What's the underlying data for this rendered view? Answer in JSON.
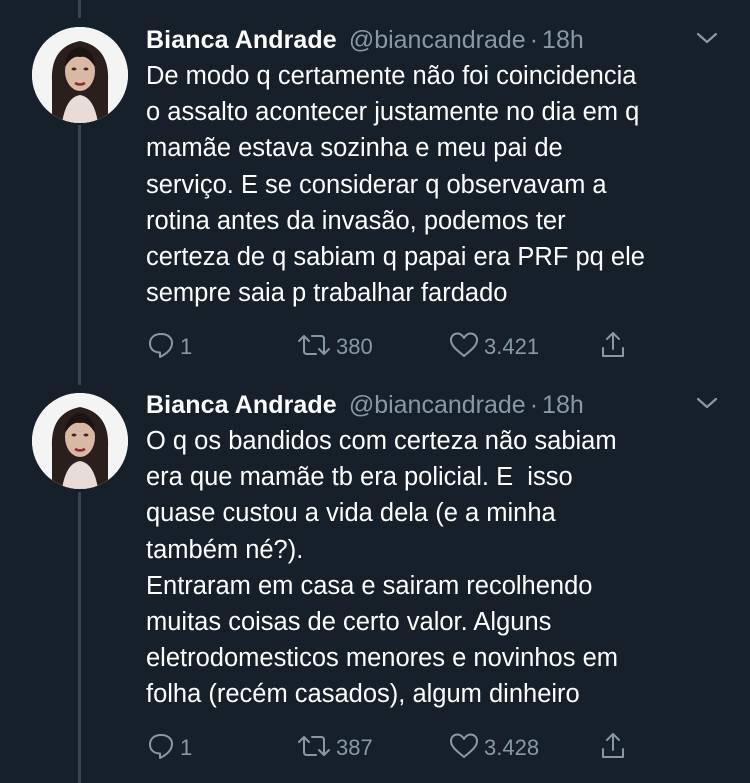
{
  "tweets": [
    {
      "name": "Bianca Andrade",
      "handle": "@biancandrade",
      "separator": "·",
      "time": "18h",
      "lines": [
        "De modo q certamente não foi coincidencia",
        "o assalto acontecer justamente no dia em q",
        "mamãe estava sozinha e meu pai de",
        "serviço. E se considerar q observavam a",
        "rotina antes da invasão, podemos ter",
        "certeza de q sabiam q papai era PRF pq ele",
        "sempre saia p trabalhar fardado"
      ],
      "replies": "1",
      "retweets": "380",
      "likes": "3.421"
    },
    {
      "name": "Bianca Andrade",
      "handle": "@biancandrade",
      "separator": "·",
      "time": "18h",
      "lines": [
        "O q os bandidos com certeza não sabiam",
        "era que mamãe tb era policial. E  isso",
        "quase custou a vida dela (e a minha",
        "também né?).",
        "Entraram em casa e sairam recolhendo",
        "muitas coisas de certo valor. Alguns",
        "eletrodomesticos menores e novinhos em",
        "folha (recém casados), algum dinheiro"
      ],
      "replies": "1",
      "retweets": "387",
      "likes": "3.428"
    }
  ],
  "colors": {
    "background": "#15202b",
    "text": "#ffffff",
    "secondary": "#8899a6",
    "thread_line": "#38444d"
  },
  "icons": [
    "reply-icon",
    "retweet-icon",
    "like-icon",
    "share-icon",
    "chevron-down-icon"
  ]
}
